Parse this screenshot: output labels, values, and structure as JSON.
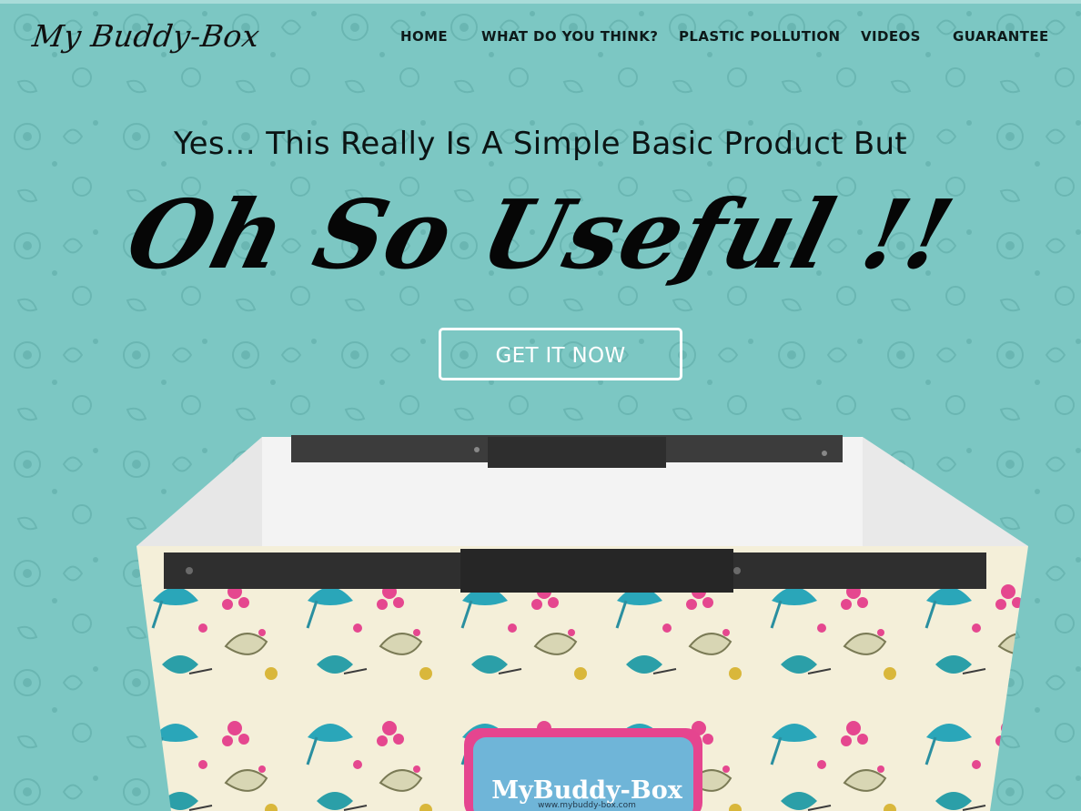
{
  "site": {
    "logo": "My Buddy-Box"
  },
  "nav": {
    "items": [
      {
        "label": "HOME"
      },
      {
        "label": "WHAT DO YOU THINK?"
      },
      {
        "label": "PLASTIC POLLUTION"
      },
      {
        "label": "VIDEOS"
      },
      {
        "label": "GUARANTEE"
      }
    ]
  },
  "hero": {
    "headline": "Yes… This Really Is A Simple Basic Product But",
    "tagline": "Oh So Useful !!",
    "cta_label": "GET IT NOW"
  },
  "product": {
    "badge_text": "MyBuddy-Box",
    "badge_url": "www.mybuddy-box.com"
  },
  "colors": {
    "background": "#7cc7c3",
    "text": "#0b1414",
    "button_border": "#ffffff",
    "badge_blue": "#6fb5d8",
    "badge_pink": "#e5458f"
  }
}
